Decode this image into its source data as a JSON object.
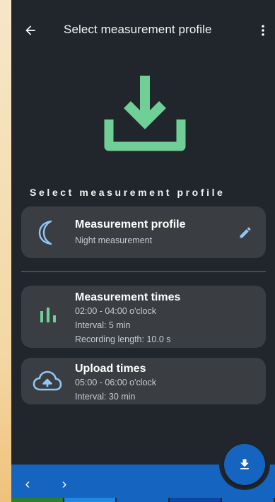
{
  "app_bar": {
    "title": "Select measurement profile",
    "back_icon": "arrow-left-icon",
    "menu_icon": "more-vertical-icon"
  },
  "hero": {
    "icon": "download-icon"
  },
  "section_label": "Select measurement profile",
  "profile_card": {
    "icon": "moon-icon",
    "title": "Measurement profile",
    "subtitle": "Night measurement",
    "edit_icon": "pencil-icon"
  },
  "times_card": {
    "icon": "bar-chart-icon",
    "title": "Measurement times",
    "lines": [
      "02:00 - 04:00 o'clock",
      "Interval: 5 min",
      "Recording length: 10.0 s"
    ]
  },
  "upload_card": {
    "icon": "cloud-upload-icon",
    "title": "Upload times",
    "lines": [
      "05:00 - 06:00 o'clock",
      "Interval: 30 min"
    ]
  },
  "bottom_nav": {
    "prev_label": "‹",
    "next_label": "›",
    "fab_icon": "download-icon"
  },
  "colors": {
    "background": "#20262b",
    "card": "#3a3e42",
    "accent_green": "#6fcf97",
    "accent_blue": "#1565c0",
    "icon_blue": "#90c7f5"
  }
}
